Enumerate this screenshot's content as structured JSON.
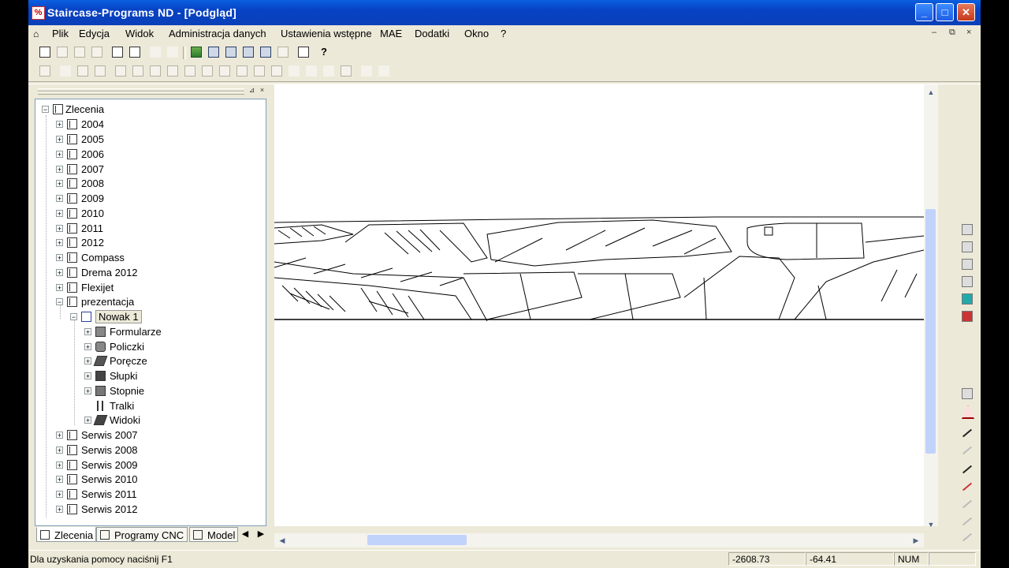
{
  "window": {
    "app_icon_glyph": "%",
    "title": "Staircase-Programs ND   - [Podgląd]",
    "controls": {
      "minimize": "_",
      "maximize": "□",
      "close": "✕"
    }
  },
  "menubar": {
    "mdi_icon_glyph": "⌂",
    "items": [
      "Plik",
      "Edycja",
      "Widok",
      "Administracja danych",
      "Ustawienia wstępne",
      "MAE",
      "Dodatki",
      "Okno",
      "?"
    ],
    "mdi_controls": {
      "minimize": "–",
      "restore": "⧉",
      "close": "×"
    }
  },
  "tree": {
    "root": "Zlecenia",
    "years": [
      "2004",
      "2005",
      "2006",
      "2007",
      "2008",
      "2009",
      "2010",
      "2011",
      "2012",
      "Compass",
      "Drema 2012",
      "Flexijet"
    ],
    "expanded": "prezentacja",
    "selected": "Nowak 1",
    "children": [
      "Formularze",
      "Policzki",
      "Poręcze",
      "Słupki",
      "Stopnie",
      "Tralki",
      "Widoki"
    ],
    "services": [
      "Serwis 2007",
      "Serwis 2008",
      "Serwis 2009",
      "Serwis 2010",
      "Serwis 2011",
      "Serwis 2012"
    ]
  },
  "tabs": [
    "Zlecenia",
    "Programy CNC",
    "Model"
  ],
  "pane_buttons": {
    "pin": "⊿",
    "close": "×"
  },
  "scroll_arrows": {
    "up": "▲",
    "down": "▼",
    "left": "◀",
    "right": "▶",
    "tab_left": "◀",
    "tab_right": "▶"
  },
  "expander_glyphs": {
    "collapsed": "+",
    "expanded": "−"
  },
  "statusbar": {
    "hint": "Dla uzyskania pomocy naciśnij  F1",
    "x": "-2608.73",
    "y": "-64.41",
    "num": "NUM"
  },
  "colors": {
    "titlebar": "#0842c4",
    "face": "#ece9d8",
    "scroll_thumb": "#c1d3fb"
  }
}
